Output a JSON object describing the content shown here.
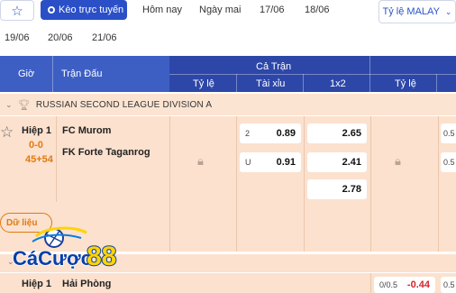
{
  "toolbar": {
    "live_label": "Kèo trực tuyến",
    "dates_row1": [
      "Hôm nay",
      "Ngày mai",
      "17/06",
      "18/06"
    ],
    "dates_row2": [
      "19/06",
      "20/06",
      "21/06"
    ],
    "odds_format": "Tỷ lệ MALAY"
  },
  "header": {
    "time": "Giờ",
    "match": "Trận Đấu",
    "full_match": "Cả Trận",
    "cols": [
      "Tỷ lệ",
      "Tài xỉu",
      "1x2",
      "Tỷ lệ"
    ]
  },
  "league": {
    "name": "RUSSIAN SECOND LEAGUE DIVISION A"
  },
  "match1": {
    "period": "Hiệp 1",
    "score": "0-0",
    "minute": "45+54",
    "home": "FC Murom",
    "away": "FK Forte Taganrog",
    "ou": [
      {
        "label": "2",
        "value": "0.89"
      },
      {
        "label": "U",
        "value": "0.91"
      }
    ],
    "x12": [
      "2.65",
      "2.41",
      "2.78"
    ],
    "right_labels": [
      "0.5",
      "0.5"
    ],
    "data_button": "Dữ liệu"
  },
  "match2": {
    "period": "Hiệp 1",
    "home": "Hải Phòng",
    "hdp_label": "0/0.5",
    "hdp_value": "-0.44",
    "right_label": "0.5"
  },
  "logo": {
    "text": "CáCược88"
  },
  "colors": {
    "header": "#3d5fc4",
    "header_dark": "#2d47a8",
    "row": "#fbe1ce",
    "accent": "#e07a10"
  }
}
